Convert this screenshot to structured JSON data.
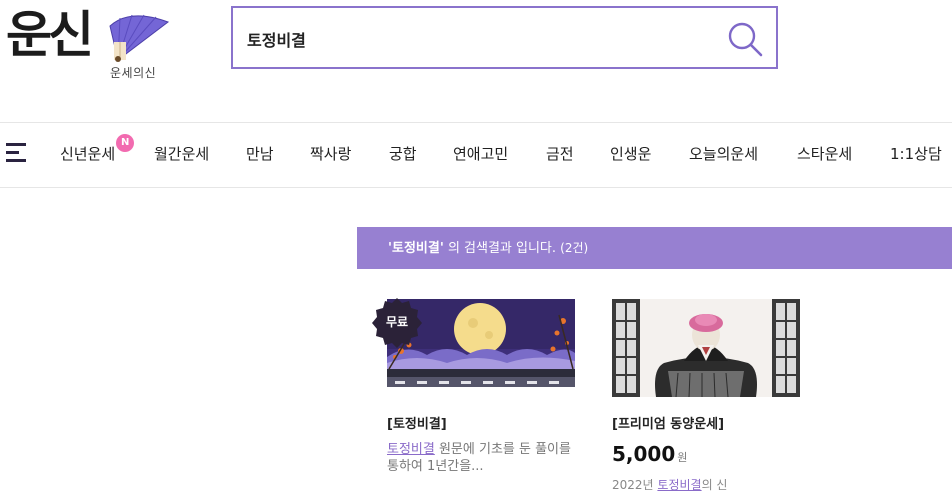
{
  "header": {
    "logo_text": "운신",
    "logo_sub": "운세의신",
    "search_value": "토정비결"
  },
  "nav": {
    "items": [
      "신년운세",
      "월간운세",
      "만남",
      "짝사랑",
      "궁합",
      "연애고민",
      "금전",
      "인생운",
      "오늘의운세",
      "스타운세",
      "1:1상담"
    ],
    "new_badge": "N"
  },
  "results": {
    "query": "'토정비결'",
    "suffix": " 의 검색결과 입니다.",
    "count": "(2건)",
    "cards": [
      {
        "badge": "무료",
        "title": "[토정비결]",
        "desc_highlight": "토정비결",
        "desc_rest": " 원문에 기초를 둔 풀이를 통하여 1년간을..."
      },
      {
        "title": "[프리미엄 동양운세]",
        "price": "5,000",
        "currency": "원",
        "meta_pre": "2022년 ",
        "meta_highlight": "토정비결",
        "meta_post": "의 신"
      }
    ]
  },
  "colors": {
    "accent": "#9780d1",
    "border": "#8a73cc",
    "badge_pink": "#f26bb0"
  }
}
